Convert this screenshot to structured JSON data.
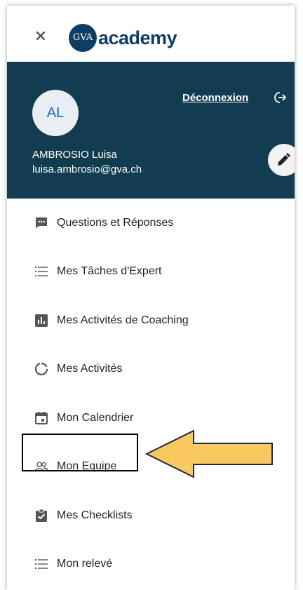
{
  "header": {
    "close_icon": "close-icon",
    "logo": {
      "badge_text": "GVA",
      "text": "academy"
    }
  },
  "user": {
    "initials": "AL",
    "name": "AMBROSIO Luisa",
    "email": "luisa.ambrosio@gva.ch",
    "logout_label": "Déconnexion",
    "logout_icon": "logout-icon",
    "edit_icon": "pencil-icon",
    "header_color": "#123c50"
  },
  "menu": {
    "items": [
      {
        "label": "Questions et Réponses",
        "icon": "chat-bubble-icon"
      },
      {
        "label": "Mes Tâches d'Expert",
        "icon": "list-icon"
      },
      {
        "label": "Mes Activités de Coaching",
        "icon": "bar-chart-icon"
      },
      {
        "label": "Mes Activités",
        "icon": "progress-ring-icon"
      },
      {
        "label": "Mon Calendrier",
        "icon": "calendar-icon"
      },
      {
        "label": "Mon Equipe",
        "icon": "team-icon"
      },
      {
        "label": "Mes Checklists",
        "icon": "clipboard-check-icon"
      },
      {
        "label": "Mon relevé",
        "icon": "list-icon"
      }
    ]
  },
  "annotation": {
    "arrow_color": "#f7c95e",
    "highlighted_item": "Mon Equipe"
  }
}
